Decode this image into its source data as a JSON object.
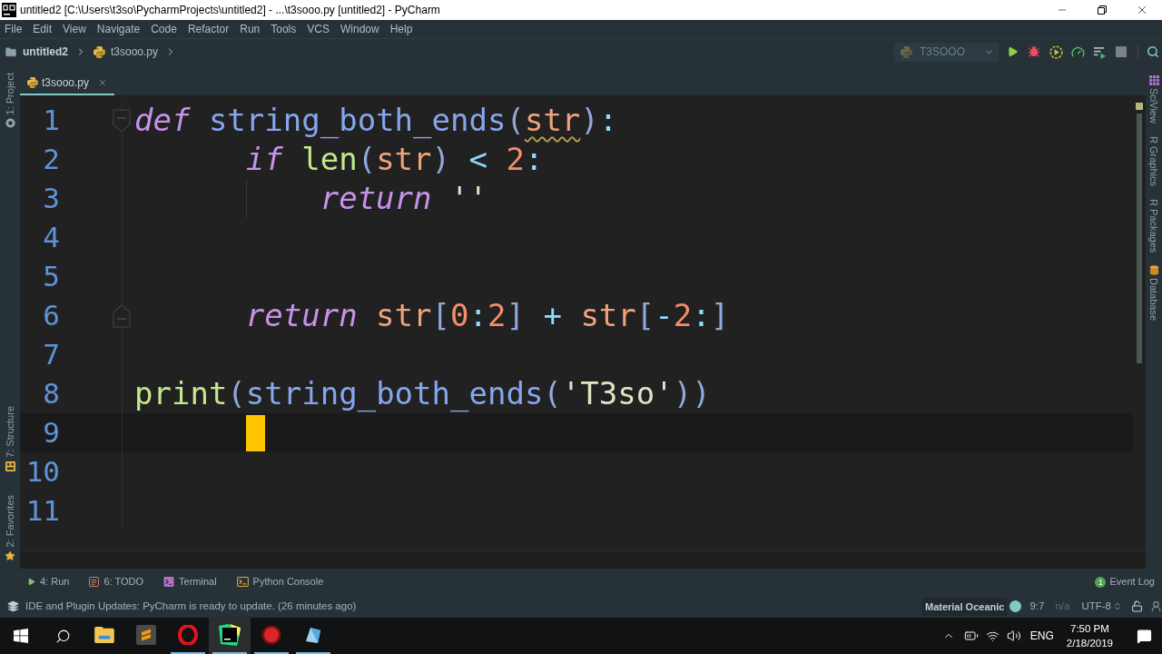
{
  "window": {
    "title": "untitled2 [C:\\Users\\t3so\\PycharmProjects\\untitled2] - ...\\t3sooo.py [untitled2] - PyCharm"
  },
  "menu": [
    "File",
    "Edit",
    "View",
    "Navigate",
    "Code",
    "Refactor",
    "Run",
    "Tools",
    "VCS",
    "Window",
    "Help"
  ],
  "breadcrumbs": [
    {
      "label": "untitled2",
      "kind": "folder"
    },
    {
      "label": "t3sooo.py",
      "kind": "python_file"
    }
  ],
  "run_configuration": {
    "label": "T3SOOO"
  },
  "left_tool_strip": {
    "top": [
      {
        "label": "1: Project",
        "kind": "project"
      }
    ],
    "bottom": [
      {
        "label": "7: Structure",
        "kind": "structure"
      },
      {
        "label": "2: Favorites",
        "kind": "favorites"
      }
    ]
  },
  "right_tool_strip": [
    {
      "label": "SciView",
      "kind": "sciview"
    },
    {
      "label": "R Graphics",
      "kind": "plain"
    },
    {
      "label": "R Packages",
      "kind": "plain"
    },
    {
      "label": "Database",
      "kind": "database"
    }
  ],
  "editor_tabs": [
    {
      "label": "t3sooo.py",
      "selected": true
    }
  ],
  "editor": {
    "lines": [
      {
        "number": "1",
        "kind": "fold_start",
        "current": false,
        "tokens": [
          {
            "text": "def",
            "kind": "keyword",
            "warning": false
          },
          {
            "text": " string_both_ends",
            "kind": "function",
            "warning": false
          },
          {
            "text": "(",
            "kind": "punct",
            "warning": false
          },
          {
            "text": "str",
            "kind": "param",
            "warning": true
          },
          {
            "text": ")",
            "kind": "punct",
            "warning": false
          },
          {
            "text": ":",
            "kind": "operator",
            "warning": false
          }
        ],
        "children": [
          {
            "number": "2",
            "kind": "line",
            "current": false,
            "tokens": [
              {
                "text": "if",
                "kind": "keyword",
                "warning": false
              },
              {
                "text": " len",
                "kind": "builtin",
                "warning": false
              },
              {
                "text": "(",
                "kind": "punct",
                "warning": false
              },
              {
                "text": "str",
                "kind": "param",
                "warning": false
              },
              {
                "text": ")",
                "kind": "punct",
                "warning": false
              },
              {
                "text": " < ",
                "kind": "operator",
                "warning": false
              },
              {
                "text": "2",
                "kind": "number",
                "warning": false
              },
              {
                "text": ":",
                "kind": "operator",
                "warning": false
              }
            ],
            "children": [
              {
                "number": "3",
                "kind": "line",
                "current": false,
                "tokens": [
                  {
                    "text": "return",
                    "kind": "keyword",
                    "warning": false
                  },
                  {
                    "text": " ''",
                    "kind": "string",
                    "warning": false
                  }
                ]
              }
            ]
          },
          {
            "number": "4",
            "kind": "line",
            "current": false
          },
          {
            "number": "5",
            "kind": "line",
            "current": false
          },
          {
            "number": "6",
            "kind": "fold_end",
            "current": false,
            "tokens": [
              {
                "text": "return",
                "kind": "keyword",
                "warning": false
              },
              {
                "text": " str",
                "kind": "param",
                "warning": false
              },
              {
                "text": "[",
                "kind": "punct",
                "warning": false
              },
              {
                "text": "0",
                "kind": "number",
                "warning": false
              },
              {
                "text": ":",
                "kind": "operator",
                "warning": false
              },
              {
                "text": "2",
                "kind": "number",
                "warning": false
              },
              {
                "text": "]",
                "kind": "punct",
                "warning": false
              },
              {
                "text": " + ",
                "kind": "operator",
                "warning": false
              },
              {
                "text": "str",
                "kind": "param",
                "warning": false
              },
              {
                "text": "[",
                "kind": "punct",
                "warning": false
              },
              {
                "text": "-",
                "kind": "operator",
                "warning": false
              },
              {
                "text": "2",
                "kind": "number",
                "warning": false
              },
              {
                "text": ":",
                "kind": "operator",
                "warning": false
              },
              {
                "text": "]",
                "kind": "punct",
                "warning": false
              }
            ]
          }
        ]
      },
      {
        "number": "7",
        "kind": "line",
        "current": false
      },
      {
        "number": "8",
        "kind": "line",
        "current": false,
        "tokens": [
          {
            "text": "print",
            "kind": "builtin",
            "warning": false
          },
          {
            "text": "(",
            "kind": "punct",
            "warning": false
          },
          {
            "text": "string_both_ends",
            "kind": "function",
            "warning": false
          },
          {
            "text": "(",
            "kind": "punct",
            "warning": false
          },
          {
            "text": "'T3so'",
            "kind": "string",
            "warning": false
          },
          {
            "text": "))",
            "kind": "punct",
            "warning": false
          }
        ]
      },
      {
        "number": "9",
        "kind": "line",
        "current": true
      },
      {
        "number": "10",
        "kind": "line",
        "current": false
      },
      {
        "number": "11",
        "kind": "line",
        "current": false
      }
    ]
  },
  "tool_windows": [
    {
      "label": "4: Run",
      "kind": "run"
    },
    {
      "label": "6: TODO",
      "kind": "todo"
    },
    {
      "label": "Terminal",
      "kind": "terminal"
    },
    {
      "label": "Python Console",
      "kind": "console"
    }
  ],
  "event_log": {
    "label": "Event Log",
    "count": "1"
  },
  "status_bar": {
    "message": "IDE and Plugin Updates: PyCharm is ready to update. (26 minutes ago)",
    "theme": "Material Oceanic",
    "position": "9:7",
    "line_separator": "n/a",
    "encoding": "UTF-8"
  },
  "taskbar": {
    "apps": [
      {
        "kind": "explorer",
        "running": false,
        "selected": false
      },
      {
        "kind": "editor",
        "running": false,
        "selected": false
      },
      {
        "kind": "browser",
        "running": true,
        "selected": false
      },
      {
        "kind": "ide",
        "running": true,
        "selected": true
      },
      {
        "kind": "recorder",
        "running": true,
        "selected": false
      },
      {
        "kind": "crystal",
        "running": true,
        "selected": false
      }
    ],
    "tray": {
      "language": "ENG",
      "time": "7:50 PM",
      "date": "2/18/2019"
    }
  }
}
